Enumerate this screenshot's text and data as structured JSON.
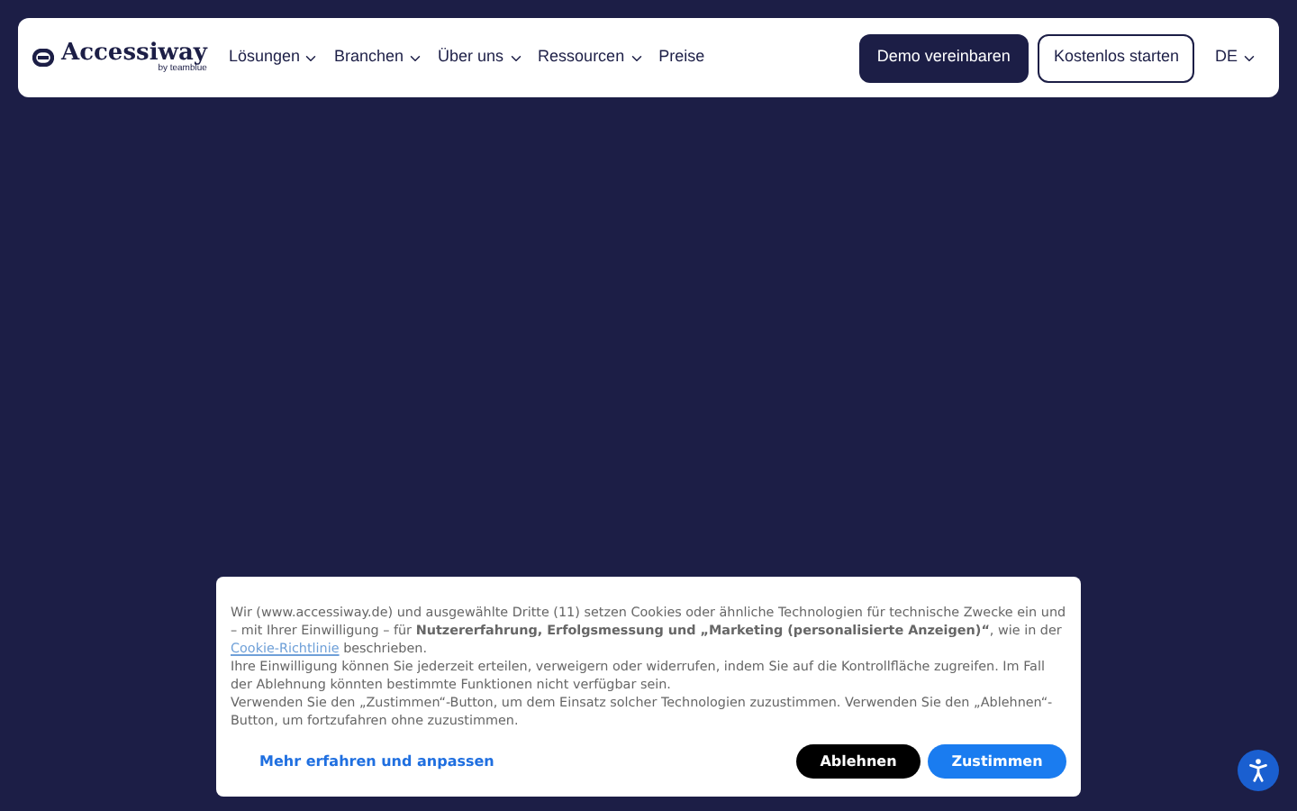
{
  "header": {
    "logo": "Accessiway",
    "logo_sub": "by teamblue",
    "nav": [
      {
        "label": "Lösungen",
        "dropdown": true
      },
      {
        "label": "Branchen",
        "dropdown": true
      },
      {
        "label": "Über uns",
        "dropdown": true
      },
      {
        "label": "Ressourcen",
        "dropdown": true
      },
      {
        "label": "Preise",
        "dropdown": false
      }
    ],
    "primary_button": "Demo vereinbaren",
    "secondary_button": "Kostenlos starten",
    "language": "DE"
  },
  "cookie_banner": {
    "paragraphs": [
      {
        "text": "Wir (www.accessiway.de) und ausgewählte Dritte (11) setzen Cookies oder ähnliche Technologien für technische Zwecke ein und – mit Ihrer Einwilligung – für **Nutzererfahrung, Erfolgsmessung und „Marketing (personalisierte Anzeigen)“**, wie in der ",
        "link": "Cookie-Richtlinie",
        "after": " beschrieben."
      },
      {
        "text": "Ihre Einwilligung können Sie jederzeit erteilen, verweigern oder widerrufen, indem Sie auf die Kontrollfläche zugreifen. Im Fall der Ablehnung könnten bestimmte Funktionen nicht verfügbar sein."
      },
      {
        "text": "Verwenden Sie den „Zustimmen“-Button, um dem Einsatz solcher Technologien zuzustimmen. Verwenden Sie den „Ablehnen“-Button, um fortzufahren ohne zuzustimmen."
      }
    ],
    "learn_more": "Mehr erfahren und anpassen",
    "reject": "Ablehnen",
    "accept": "Zustimmen"
  }
}
